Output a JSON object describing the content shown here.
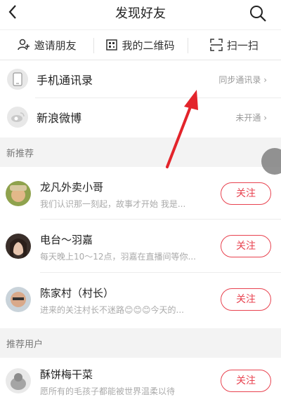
{
  "header": {
    "title": "发现好友"
  },
  "actions": [
    {
      "label": "邀请朋友",
      "icon": "add-person-icon"
    },
    {
      "label": "我的二维码",
      "icon": "qr-code-icon"
    },
    {
      "label": "扫一扫",
      "icon": "scan-icon"
    }
  ],
  "contacts": {
    "label": "手机通讯录",
    "right": "同步通讯录 ›"
  },
  "weibo": {
    "label": "新浪微博",
    "right": "未开通 ›"
  },
  "sections": {
    "new": "新推荐",
    "recommended": "推荐用户"
  },
  "users": [
    {
      "name": "龙凡外卖小哥",
      "desc": "我们认识那一刻起，故事才开始   我是...",
      "button": "关注"
    },
    {
      "name": "电台～羽嘉",
      "desc": "每天晚上10～12点，羽嘉在直播间等你...",
      "button": "关注"
    },
    {
      "name": "陈家村（村长）",
      "desc": "进来的关注村长不迷路😊😊😊今天的...",
      "button": "关注"
    },
    {
      "name": "酥饼梅干菜",
      "desc": "愿所有的毛孩子都能被世界温柔以待",
      "button": "关注"
    }
  ],
  "colors": {
    "accent": "#e8424f",
    "arrow": "#e3242b"
  }
}
